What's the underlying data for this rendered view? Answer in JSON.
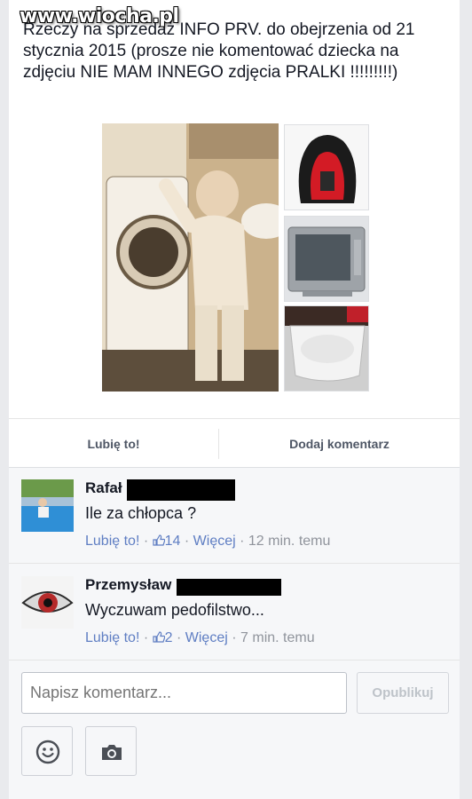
{
  "post": {
    "text": "Rzeczy na sprzedaż INFO PRV. do obejrzenia od 21 stycznia 2015 (prosze nie komentować dziecka na zdjęciu NIE MAM INNEGO zdjęcia PRALKI !!!!!!!!!)",
    "watermark": "www.wiocha.pl",
    "photos": [
      {
        "name": "main-photo",
        "icon": "washing-machine-child-photo"
      },
      {
        "name": "car-seat-photo",
        "icon": "car-seat-photo"
      },
      {
        "name": "tv-photo",
        "icon": "tv-photo"
      },
      {
        "name": "bathtub-photo",
        "icon": "bathtub-photo"
      }
    ]
  },
  "actions": {
    "like_label": "Lubię to!",
    "comment_label": "Dodaj komentarz"
  },
  "comments": [
    {
      "author": "Rafał",
      "text": "Ile za chłopca ?",
      "like_label": "Lubię to!",
      "likes": "14",
      "more_label": "Więcej",
      "time": "12 min. temu"
    },
    {
      "author": "Przemysław",
      "text": "Wyczuwam pedofilstwo...",
      "like_label": "Lubię to!",
      "likes": "2",
      "more_label": "Więcej",
      "time": "7 min. temu"
    }
  ],
  "composer": {
    "placeholder": "Napisz komentarz...",
    "publish_label": "Opublikuj"
  },
  "colors": {
    "link": "#5f7ec3",
    "meta": "#90949c",
    "background": "#e9eaed"
  }
}
